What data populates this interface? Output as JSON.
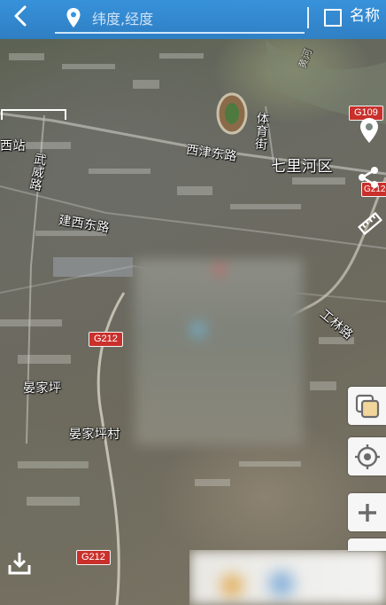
{
  "search": {
    "placeholder": "纬度,经度"
  },
  "name_toggle": {
    "label": "名称",
    "checked": false
  },
  "map": {
    "district": "七里河区",
    "labels": {
      "west_station": "西站",
      "wuwei_road": "武威路",
      "xijin_east_road": "西津东路",
      "tiyu_street": "体育街",
      "jianxi_east_road": "建西东路",
      "gongling_road": "工林路",
      "yanjiaping": "晏家坪",
      "yanjiaping_village": "晏家坪村",
      "river": "黄河"
    },
    "route_shields": {
      "g212_top": "G212",
      "g212_bottom": "G212",
      "g109": "G109",
      "g212_right": "G212"
    }
  },
  "icons": {
    "back": "back-arrow-icon",
    "search_pin": "location-pin-icon",
    "place_pin": "map-pin-icon",
    "share": "share-icon",
    "ruler": "ruler-icon",
    "layers": "layers-icon",
    "locate": "locate-icon",
    "zoom_in": "zoom-in-icon",
    "download": "download-icon"
  },
  "colors": {
    "topbar": "#3496e6",
    "shield": "#c9302c",
    "panel": "#f6f6f6",
    "icon": "#6b6b6b"
  }
}
